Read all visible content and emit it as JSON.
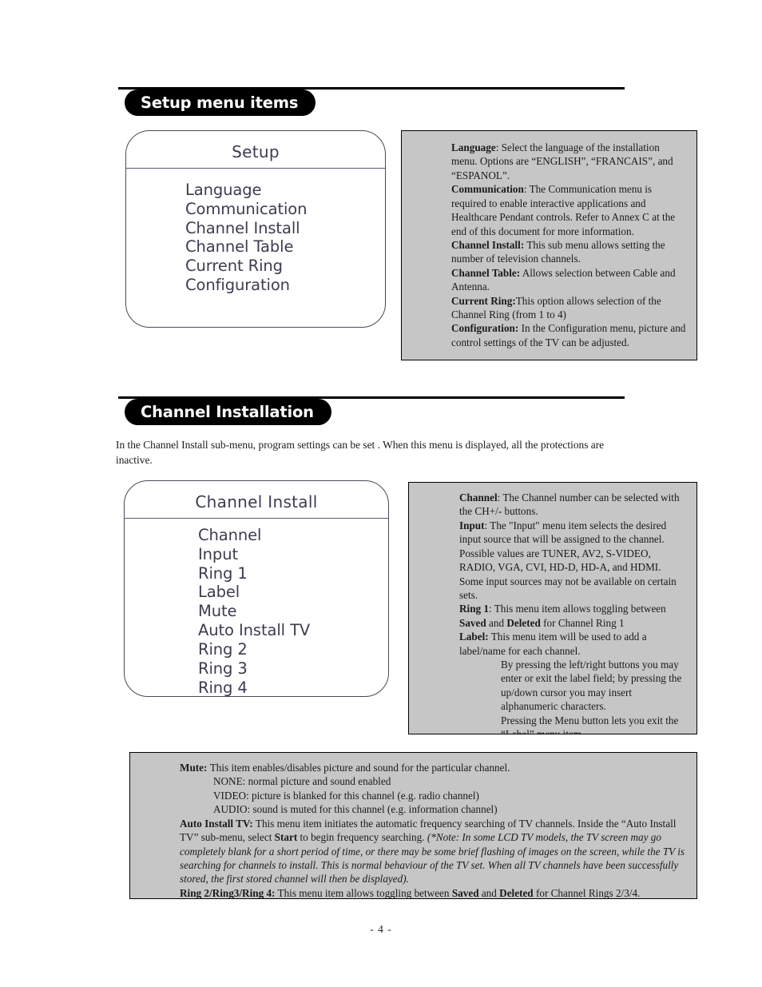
{
  "page": {
    "number_label": "- 4 -"
  },
  "sections": [
    {
      "heading": "Setup menu items",
      "menu": {
        "title": "Setup",
        "items": [
          "Language",
          "Communication",
          "Channel Install",
          "Channel Table",
          "Current Ring",
          "Configuration"
        ]
      }
    },
    {
      "heading": "Channel  Installation",
      "intro": "In the Channel Install sub-menu, program settings can be set . When this menu is displayed, all the protections are inactive.",
      "menu": {
        "title": "Channel Install",
        "items": [
          "Channel",
          "Input",
          "Ring 1",
          "Label",
          "Mute",
          "Auto Install TV",
          "Ring 2",
          "Ring 3",
          "Ring 4"
        ]
      }
    }
  ],
  "setup_descriptions": [
    {
      "term": "Language",
      "sep": ": ",
      "text": "Select the language of the installation menu. Options are “ENGLISH”, “FRANCAIS”, and “ESPANOL”."
    },
    {
      "term": "Communication",
      "sep": ": ",
      "text": "The Communication menu is required to enable interactive applications and Healthcare Pendant controls.  Refer to Annex C at the end of this document for more information."
    },
    {
      "term": "Channel Install:",
      "sep": " ",
      "text": "This sub menu allows setting the number of television channels."
    },
    {
      "term": "Channel Table:",
      "sep": " ",
      "text": "Allows selection between Cable and Antenna."
    },
    {
      "term": "Current Ring:",
      "sep": "",
      "text": "This option allows selection of the Channel Ring (from 1 to 4)"
    },
    {
      "term": "Configuration:",
      "sep": " ",
      "text": "In the Configuration menu, picture and control settings of the TV can be adjusted."
    }
  ],
  "channel_descriptions": {
    "channel": {
      "term": "Channel",
      "sep": ": ",
      "text": "The Channel number can be selected with the CH+/- buttons."
    },
    "input": {
      "term": "Input",
      "sep": ": ",
      "text": "The \"Input\" menu item selects the desired input source that will be assigned to the channel. Possible values are TUNER, AV2, S-VIDEO, RADIO, VGA, CVI, HD-D, HD-A, and HDMI. Some input sources may not be available on certain sets."
    },
    "ring1": {
      "term": "Ring 1",
      "sep": ": ",
      "text_pre": "This menu item allows toggling between ",
      "bold_a": "Saved",
      "mid": " and ",
      "bold_b": "Deleted",
      "text_post": " for Channel Ring 1"
    },
    "label": {
      "term": "Label:",
      "sep": " ",
      "text": "This menu item will be used to add a label/name for each channel."
    },
    "label_note_1": "By pressing the left/right buttons you may enter or exit the label field; by pressing the up/down cursor you may insert alphanumeric characters.",
    "label_note_2": "Pressing the Menu button lets you exit the “Label” menu item."
  },
  "bottom_box": {
    "mute": {
      "term": "Mute:",
      "text": "This item enables/disables picture and sound for the particular channel."
    },
    "mute_options": [
      "NONE: normal picture and sound enabled",
      "VIDEO: picture is blanked for this channel (e.g. radio channel)",
      "AUDIO: sound is muted for this channel (e.g. information channel)"
    ],
    "auto_install": {
      "term": "Auto Install TV:",
      "text_a": "This menu item initiates the automatic frequency searching of TV channels. Inside the “Auto Install TV” sub-menu, select ",
      "bold_start": "Start",
      "text_b": " to begin frequency searching.  ",
      "italic_note": "(*Note: In some LCD TV models, the TV screen may go completely blank for a short period of time, or there may be some brief flashing of images on the screen, while the TV is searching for channels to install. This is normal behaviour of the TV set. When all TV channels have been successfully stored, the first stored channel will then be displayed)."
    },
    "rings": {
      "term": "Ring 2/Ring3/Ring 4:",
      "text_pre": " This menu item allows toggling between ",
      "bold_a": "Saved",
      "mid": " and ",
      "bold_b": "Deleted",
      "text_post": " for Channel Rings 2/3/4."
    }
  },
  "colors": {
    "gray_panel": "#c6c6c6",
    "menu_text": "#3c3c50",
    "header_bar": "#000000"
  }
}
